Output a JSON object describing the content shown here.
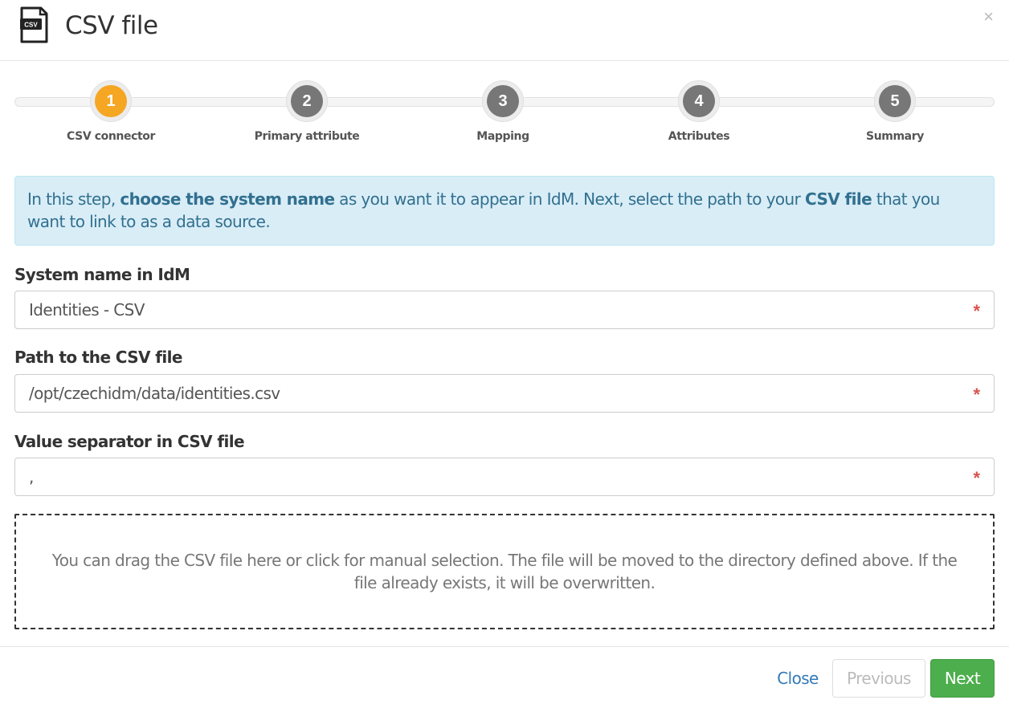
{
  "header": {
    "title": "CSV file",
    "icon_label": "CSV",
    "close_symbol": "×"
  },
  "wizard": {
    "steps": [
      {
        "number": "1",
        "label": "CSV connector",
        "active": true
      },
      {
        "number": "2",
        "label": "Primary attribute",
        "active": false
      },
      {
        "number": "3",
        "label": "Mapping",
        "active": false
      },
      {
        "number": "4",
        "label": "Attributes",
        "active": false
      },
      {
        "number": "5",
        "label": "Summary",
        "active": false
      }
    ]
  },
  "info": {
    "part1": "In this step, ",
    "bold1": "choose the system name",
    "part2": " as you want it to appear in IdM. Next, select the path to your ",
    "bold2": "CSV file",
    "part3": " that you want to link to as a data source."
  },
  "form": {
    "system_name": {
      "label": "System name in IdM",
      "value": "Identities - CSV",
      "required_mark": "*"
    },
    "path": {
      "label": "Path to the CSV file",
      "value": "/opt/czechidm/data/identities.csv",
      "required_mark": "*"
    },
    "separator": {
      "label": "Value separator in CSV file",
      "value": ",",
      "required_mark": "*"
    }
  },
  "dropzone": {
    "text": "You can drag the CSV file here or click for manual selection. The file will be moved to the directory defined above. If the file already exists, it will be overwritten."
  },
  "footer": {
    "close_label": "Close",
    "previous_label": "Previous",
    "next_label": "Next"
  },
  "colors": {
    "active_step": "#f5a623",
    "inactive_step": "#777777",
    "info_bg": "#d9edf7",
    "info_text": "#31708f",
    "next_button": "#4cae4c",
    "required": "#d9534f",
    "link": "#337ab7"
  }
}
